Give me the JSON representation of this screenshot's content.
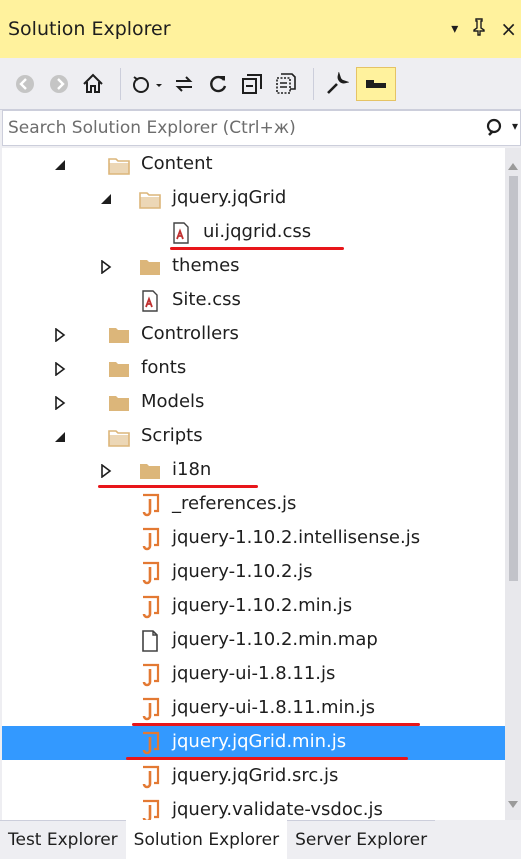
{
  "window": {
    "title": "Solution Explorer",
    "pin_glyph": "▾",
    "dock_glyph": "⊥",
    "close_glyph": "×"
  },
  "search": {
    "placeholder": "Search Solution Explorer (Ctrl+ж)"
  },
  "tree": [
    {
      "label": "Content",
      "icon": "folder-open-icon",
      "expander": "expanded",
      "level": 1
    },
    {
      "label": "jquery.jqGrid",
      "icon": "folder-open-icon",
      "expander": "expanded",
      "level": 2
    },
    {
      "label": "ui.jqgrid.css",
      "icon": "css-file-icon",
      "expander": "none",
      "level": 3
    },
    {
      "label": "themes",
      "icon": "folder-icon",
      "expander": "collapsed",
      "level": 2
    },
    {
      "label": "Site.css",
      "icon": "css-file-icon",
      "expander": "none",
      "level": 2
    },
    {
      "label": "Controllers",
      "icon": "folder-icon",
      "expander": "collapsed",
      "level": 1
    },
    {
      "label": "fonts",
      "icon": "folder-icon",
      "expander": "collapsed",
      "level": 1
    },
    {
      "label": "Models",
      "icon": "folder-icon",
      "expander": "collapsed",
      "level": 1
    },
    {
      "label": "Scripts",
      "icon": "folder-open-icon",
      "expander": "expanded",
      "level": 1
    },
    {
      "label": "i18n",
      "icon": "folder-icon",
      "expander": "collapsed",
      "level": 2
    },
    {
      "label": "_references.js",
      "icon": "js-file-icon",
      "expander": "none",
      "level": 2
    },
    {
      "label": "jquery-1.10.2.intellisense.js",
      "icon": "js-file-icon",
      "expander": "none",
      "level": 2
    },
    {
      "label": "jquery-1.10.2.js",
      "icon": "js-file-icon",
      "expander": "none",
      "level": 2
    },
    {
      "label": "jquery-1.10.2.min.js",
      "icon": "js-file-icon",
      "expander": "none",
      "level": 2
    },
    {
      "label": "jquery-1.10.2.min.map",
      "icon": "file-icon",
      "expander": "none",
      "level": 2
    },
    {
      "label": "jquery-ui-1.8.11.js",
      "icon": "js-file-icon",
      "expander": "none",
      "level": 2
    },
    {
      "label": "jquery-ui-1.8.11.min.js",
      "icon": "js-file-icon",
      "expander": "none",
      "level": 2
    },
    {
      "label": "jquery.jqGrid.min.js",
      "icon": "js-file-icon",
      "expander": "none",
      "level": 2,
      "selected": true
    },
    {
      "label": "jquery.jqGrid.src.js",
      "icon": "js-file-icon",
      "expander": "none",
      "level": 2
    },
    {
      "label": "jquery.validate-vsdoc.js",
      "icon": "js-file-icon",
      "expander": "none",
      "level": 2
    }
  ],
  "bottom_tabs": [
    {
      "label": "Test Explorer",
      "active": false
    },
    {
      "label": "Solution Explorer",
      "active": true
    },
    {
      "label": "Server Explorer",
      "active": false
    }
  ],
  "colors": {
    "title_bar": "#fff29d",
    "selection": "#3399ff",
    "annotation_underline": "#e8161a",
    "folder": "#dcb67a",
    "js_icon": "#e37933",
    "css_icon": "#c03030"
  }
}
